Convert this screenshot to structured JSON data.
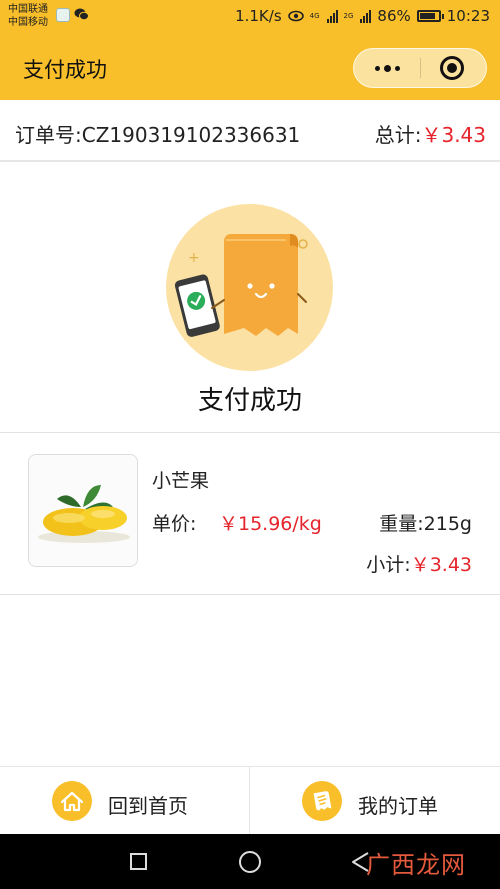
{
  "status_bar": {
    "carrier_1": "中国联通",
    "carrier_2": "中国移动",
    "net_speed": "1.1K/s",
    "net_tag_1": "4G",
    "net_tag_2": "2G",
    "battery": "86%",
    "battery_level": 0.86,
    "time": "10:23"
  },
  "navbar": {
    "title": "支付成功",
    "more_icon": "more-dots-icon",
    "close_icon": "target-circle-icon"
  },
  "order": {
    "number_label": "订单号:",
    "number": "CZ190319102336631",
    "total_label": "总计:",
    "total": "￥3.43"
  },
  "success": {
    "illustration": "payment-success-illustration",
    "text": "支付成功"
  },
  "product": {
    "image": "mango-image",
    "name": "小芒果",
    "price_label": "单价:",
    "price": "￥15.96/kg",
    "weight_label": "重量:",
    "weight": "215g",
    "subtotal_label": "小计:",
    "subtotal": "￥3.43"
  },
  "bottom_bar": {
    "home_label": "回到首页",
    "home_icon": "home-icon",
    "orders_label": "我的订单",
    "orders_icon": "receipt-icon"
  },
  "android_nav": {
    "recents_icon": "square-icon",
    "home_icon": "circle-icon",
    "back_icon": "triangle-back-icon",
    "watermark": "广西龙网"
  },
  "colors": {
    "accent": "#f9bf2a",
    "price_red": "#e5242b"
  }
}
